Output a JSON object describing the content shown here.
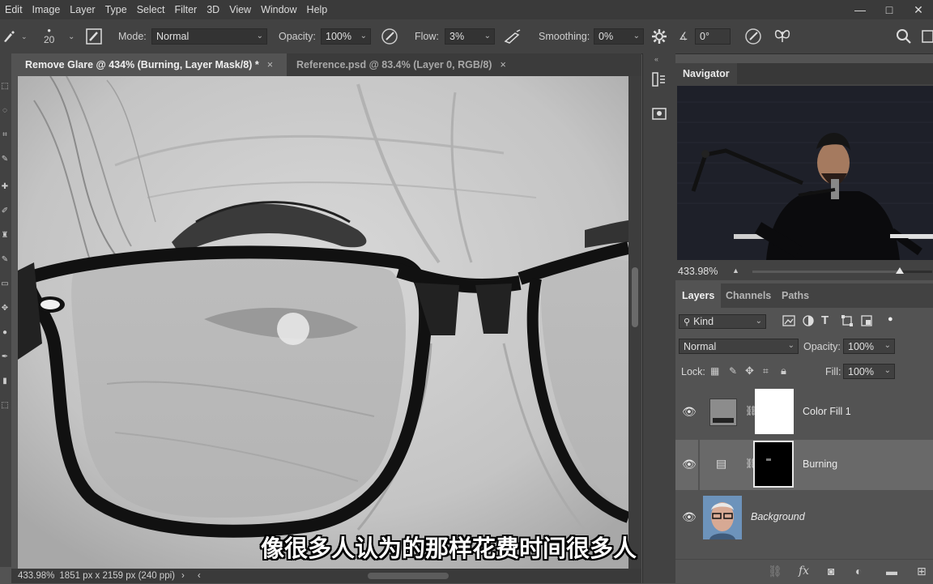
{
  "menubar": {
    "items": [
      "Edit",
      "Image",
      "Layer",
      "Type",
      "Select",
      "Filter",
      "3D",
      "View",
      "Window",
      "Help"
    ],
    "window_controls": [
      "—",
      "□",
      "✕"
    ]
  },
  "options": {
    "brush_size": "20",
    "mode_label": "Mode:",
    "mode_value": "Normal",
    "opacity_label": "Opacity:",
    "opacity_value": "100%",
    "flow_label": "Flow:",
    "flow_value": "3%",
    "smoothing_label": "Smoothing:",
    "smoothing_value": "0%",
    "angle_value": "0°"
  },
  "tabs": [
    {
      "label": "Remove Glare @ 434% (Burning, Layer Mask/8) *",
      "close": "×"
    },
    {
      "label": "Reference.psd @ 83.4% (Layer 0, RGB/8)",
      "close": "×"
    }
  ],
  "statusbar": {
    "zoom": "433.98%",
    "doc_info": "1851 px x 2159 px (240 ppi)",
    "more": "›",
    "left_arrow": "‹"
  },
  "subtitle": "像很多人认为的那样花费时间很多人",
  "navigator": {
    "title": "Navigator",
    "zoom": "433.98%",
    "slider_level": 0.82
  },
  "layers_panel": {
    "tabs": [
      "Layers",
      "Channels",
      "Paths"
    ],
    "kind_label": "Kind",
    "blend_mode": "Normal",
    "opacity_label": "Opacity:",
    "opacity_value": "100%",
    "lock_label": "Lock:",
    "fill_label": "Fill:",
    "fill_value": "100%",
    "layers": [
      {
        "name": "Color Fill 1",
        "visible": true,
        "selected": false
      },
      {
        "name": "Burning",
        "visible": true,
        "selected": true
      },
      {
        "name": "Background",
        "visible": true,
        "selected": false
      }
    ]
  },
  "colors": {
    "app_bg": "#535353",
    "panel_bg": "#424242",
    "selected_layer": "#696969"
  }
}
